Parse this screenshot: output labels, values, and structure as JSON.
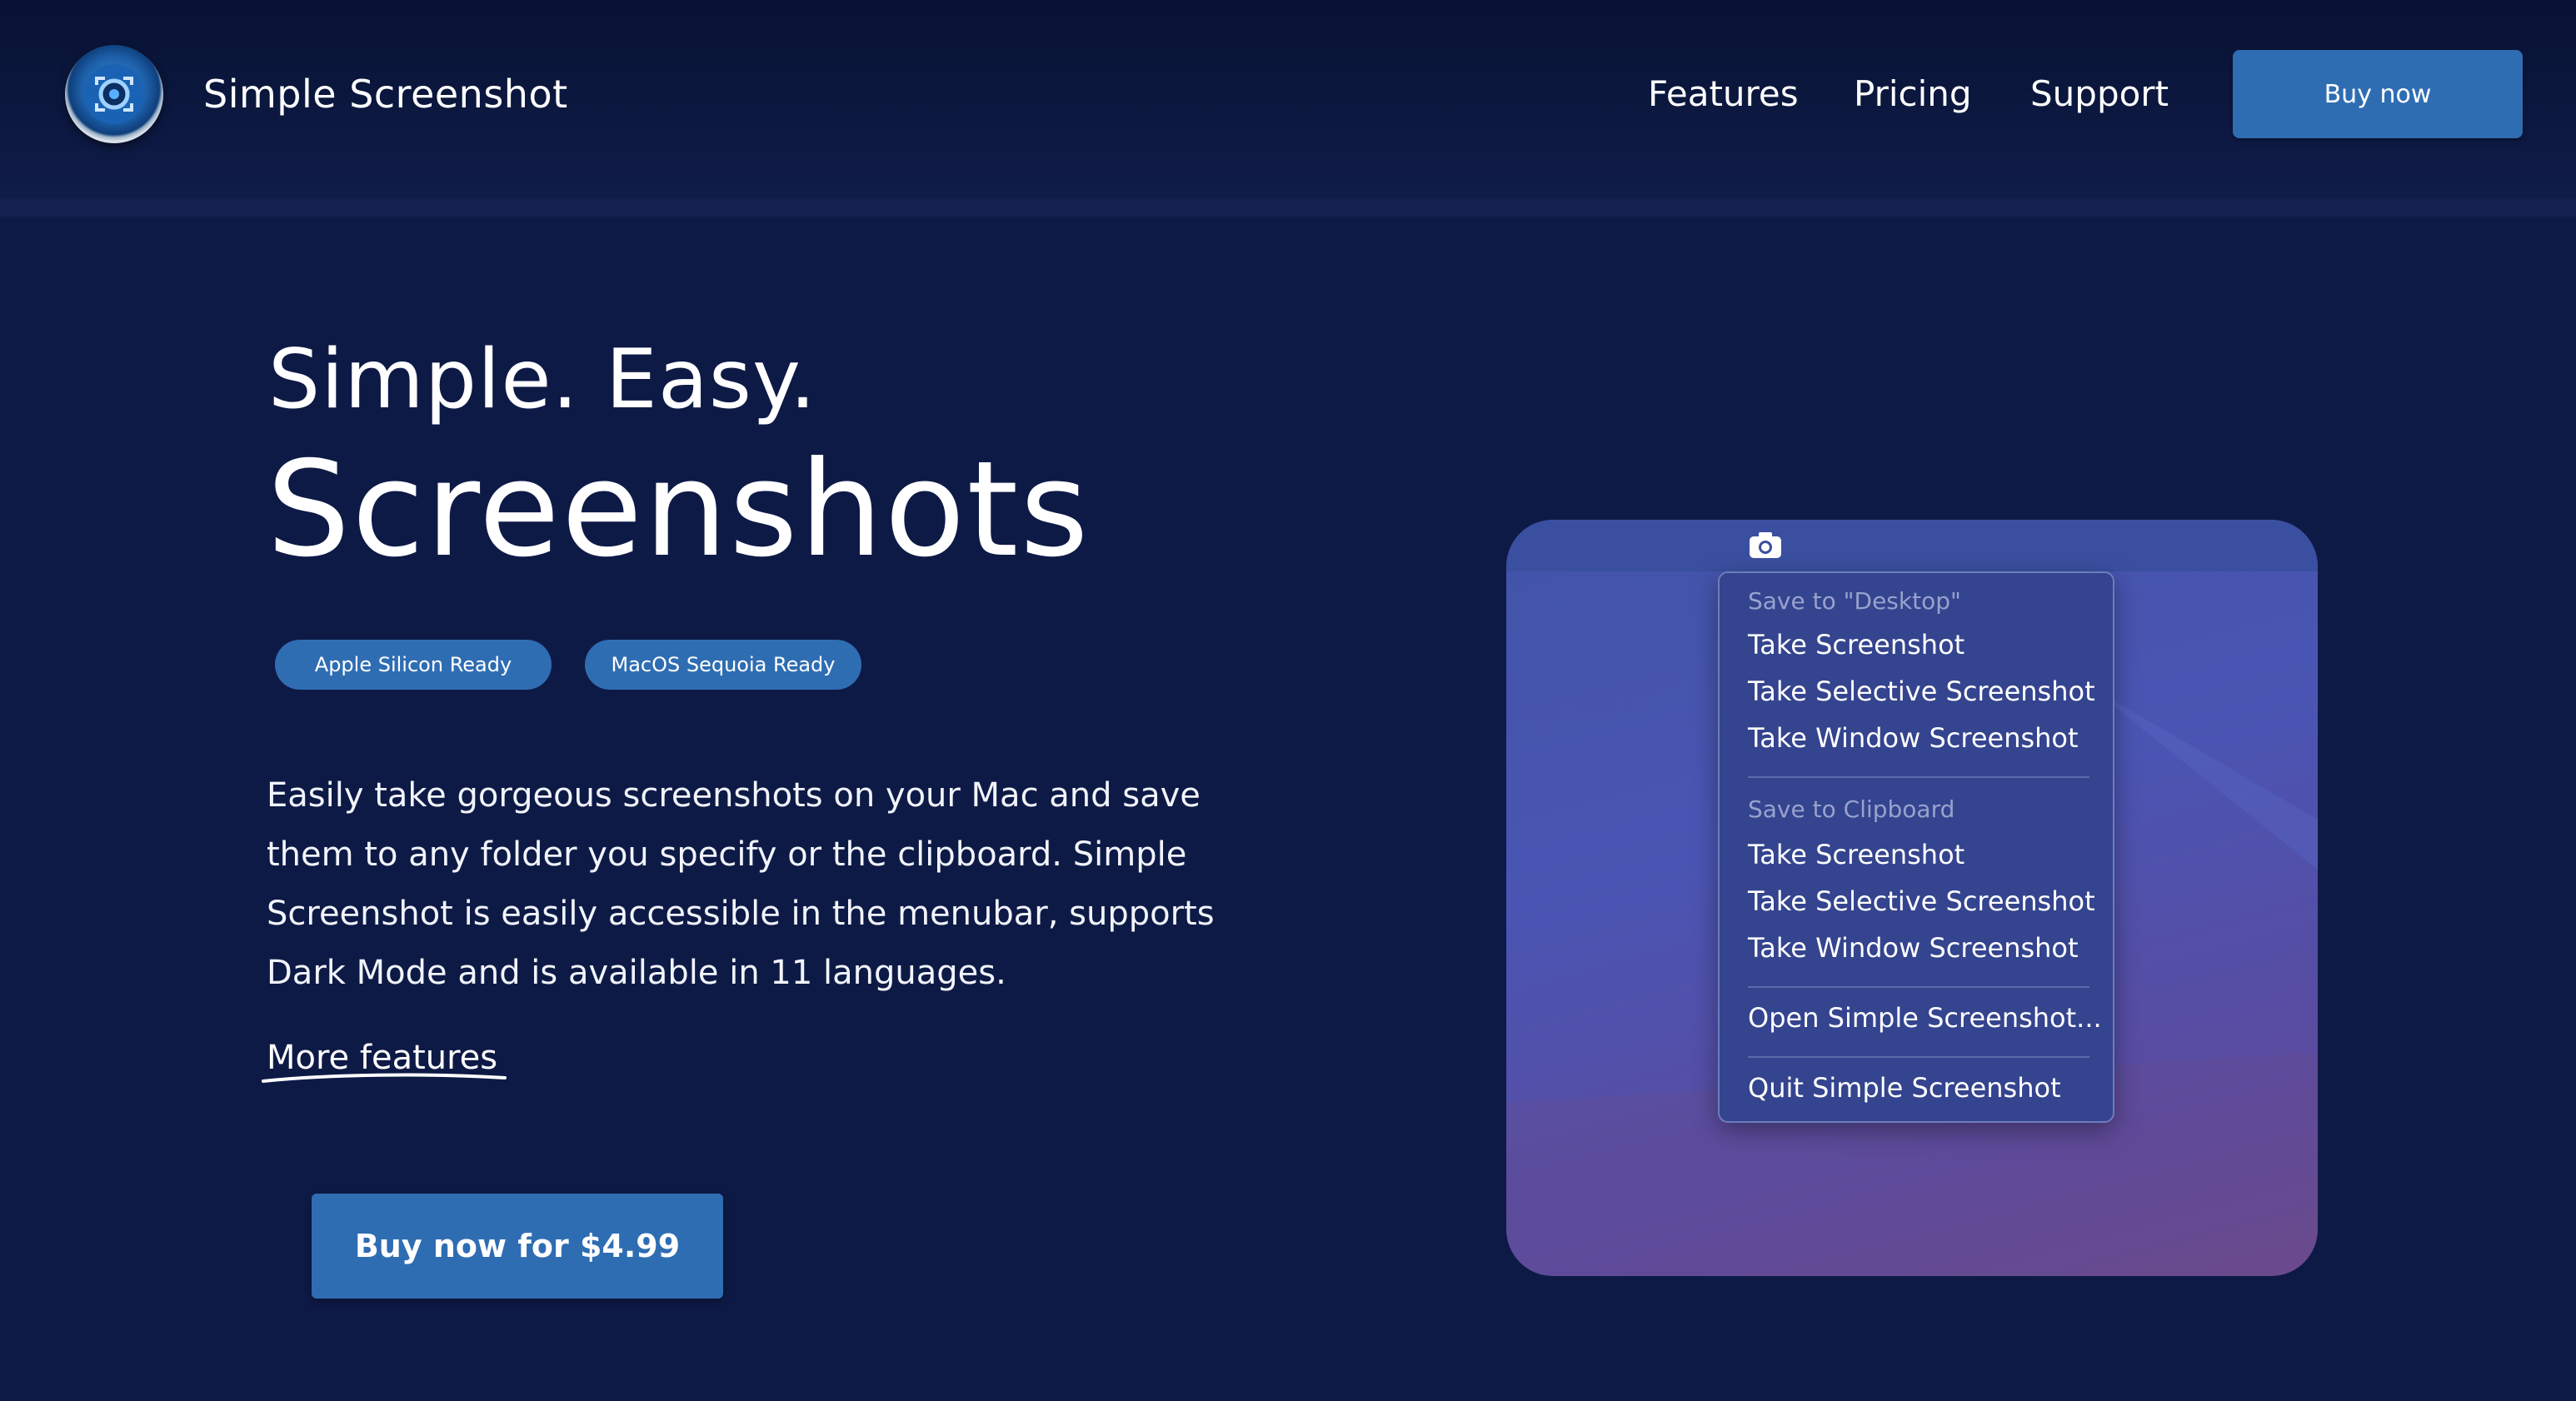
{
  "header": {
    "brand": "Simple Screenshot",
    "logo_icon": "camera-lens-icon",
    "nav": [
      {
        "label": "Features"
      },
      {
        "label": "Pricing"
      },
      {
        "label": "Support"
      }
    ],
    "buy_label": "Buy now"
  },
  "hero": {
    "tagline": "Simple. Easy.",
    "headline": "Screenshots",
    "badges": [
      "Apple Silicon Ready",
      "MacOS Sequoia Ready"
    ],
    "description": "Easily take gorgeous screenshots on your Mac and save them to any folder you specify or the clipboard. Simple Screenshot is easily accessible in the menubar, supports Dark Mode and is available in 11 languages.",
    "more_link": "More features",
    "buy_label": "Buy now for $4.99"
  },
  "preview": {
    "menubar_icon": "camera-icon",
    "menu": {
      "desktop_heading": "Save to \"Desktop\"",
      "desktop_items": [
        "Take Screenshot",
        "Take Selective Screenshot",
        "Take Window Screenshot"
      ],
      "clipboard_heading": "Save to Clipboard",
      "clipboard_items": [
        "Take Screenshot",
        "Take Selective Screenshot",
        "Take Window Screenshot"
      ],
      "open_label": "Open Simple Screenshot...",
      "quit_label": "Quit Simple Screenshot"
    }
  },
  "colors": {
    "page_background": "#0e1a46",
    "header_background": "#081234",
    "accent": "#2f6db3",
    "preview_background": "#4a55b3",
    "menu_background": "#34448f"
  }
}
